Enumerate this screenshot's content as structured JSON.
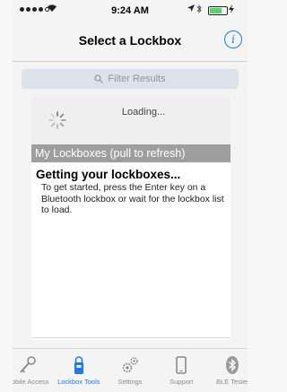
{
  "status_bar": {
    "time": "9:24 AM"
  },
  "nav": {
    "title": "Select a Lockbox",
    "info_label": "i"
  },
  "search": {
    "placeholder": "Filter Results"
  },
  "loading": {
    "text": "Loading..."
  },
  "section": {
    "header": "My Lockboxes (pull to refresh)"
  },
  "message": {
    "title": "Getting your lockboxes...",
    "body": "To get started, press the Enter key on a Bluetooth lockbox or wait for the lockbox list to load."
  },
  "tabs": [
    {
      "label": "Mobile Access",
      "icon": "key-icon",
      "active": false
    },
    {
      "label": "Lockbox Tools",
      "icon": "lockbox-icon",
      "active": true
    },
    {
      "label": "Settings",
      "icon": "gears-icon",
      "active": false
    },
    {
      "label": "Support",
      "icon": "phone-icon",
      "active": false
    },
    {
      "label": "BLE Tester",
      "icon": "bluetooth-icon",
      "active": false
    }
  ],
  "colors": {
    "accent": "#1a7cf2",
    "section_header": "#9e9e9e",
    "search_bg": "#dde2ea"
  }
}
